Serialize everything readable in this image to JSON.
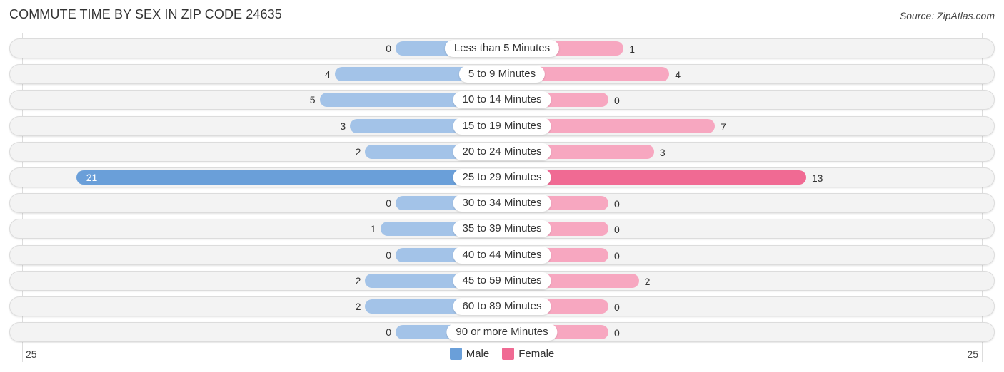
{
  "header": {
    "title": "COMMUTE TIME BY SEX IN ZIP CODE 24635",
    "source": "Source: ZipAtlas.com"
  },
  "colors": {
    "male": "#6a9fd9",
    "male_light": "#a3c3e8",
    "female": "#f06a93",
    "female_light": "#f7a7c0"
  },
  "chart_data": {
    "type": "bar",
    "orientation": "horizontal-diverging",
    "title": "COMMUTE TIME BY SEX IN ZIP CODE 24635",
    "categories": [
      "Less than 5 Minutes",
      "5 to 9 Minutes",
      "10 to 14 Minutes",
      "15 to 19 Minutes",
      "20 to 24 Minutes",
      "25 to 29 Minutes",
      "30 to 34 Minutes",
      "35 to 39 Minutes",
      "40 to 44 Minutes",
      "45 to 59 Minutes",
      "60 to 89 Minutes",
      "90 or more Minutes"
    ],
    "series": [
      {
        "name": "Male",
        "values": [
          0,
          4,
          5,
          3,
          2,
          21,
          0,
          1,
          0,
          2,
          2,
          0
        ]
      },
      {
        "name": "Female",
        "values": [
          1,
          4,
          0,
          7,
          3,
          13,
          0,
          0,
          0,
          2,
          0,
          0
        ]
      }
    ],
    "xlim": [
      25,
      25
    ],
    "axis_tick_labels": {
      "left": "25",
      "right": "25"
    },
    "legend": {
      "position": "bottom-center",
      "entries": [
        "Male",
        "Female"
      ]
    },
    "grid": false
  },
  "legend": {
    "male_label": "Male",
    "female_label": "Female"
  },
  "axis": {
    "left_label": "25",
    "right_label": "25"
  }
}
